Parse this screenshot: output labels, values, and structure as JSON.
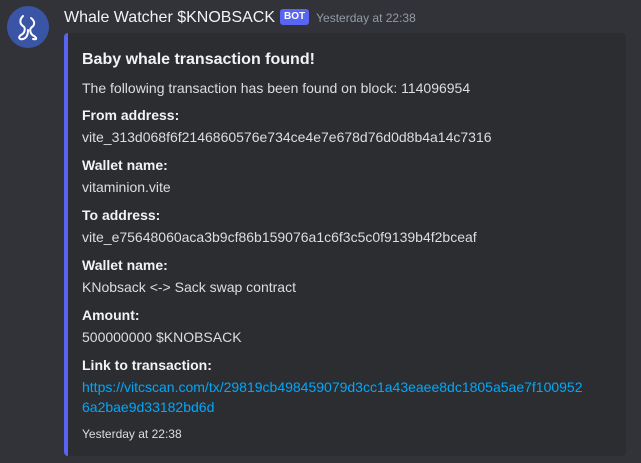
{
  "message": {
    "author": "Whale Watcher $KNOBSACK",
    "bot_tag": "BOT",
    "timestamp": "Yesterday at 22:38",
    "avatar_icon": "swirl-logo-icon"
  },
  "embed": {
    "accent_color": "#5865f2",
    "title": "Baby whale transaction found!",
    "description": "The following transaction has been found on block: 114096954",
    "fields": [
      {
        "name": "From address:",
        "value": "vite_313d068f6f2146860576e734ce4e7e678d76d0d8b4a14c7316"
      },
      {
        "name": "Wallet name:",
        "value": "vitaminion.vite"
      },
      {
        "name": "To address:",
        "value": "vite_e75648060aca3b9cf86b159076a1c6f3c5c0f9139b4f2bceaf"
      },
      {
        "name": "Wallet name:",
        "value": "KNobsack <-> Sack swap contract"
      },
      {
        "name": "Amount:",
        "value": "500000000 $KNOBSACK"
      }
    ],
    "link_field": {
      "name": "Link to transaction:",
      "line1": "https://vitcscan.com/tx/29819cb498459079d3cc1a43eaee8dc1805a5ae7f100952",
      "line2": "6a2bae9d33182bd6d"
    },
    "footer": "Yesterday at 22:38"
  }
}
